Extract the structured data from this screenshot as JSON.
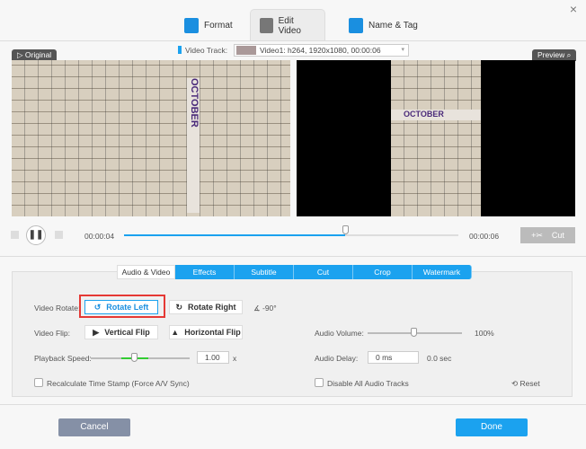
{
  "header": {
    "tabs": [
      {
        "label": "Format",
        "icon": "format-icon"
      },
      {
        "label": "Edit Video",
        "icon": "edit-video-icon",
        "active": true
      },
      {
        "label": "Name & Tag",
        "icon": "name-tag-icon"
      }
    ],
    "close": "×"
  },
  "track": {
    "label": "Video Track:",
    "value": "Video1: h264, 1920x1080, 00:00:06"
  },
  "preview": {
    "original_label": "Original",
    "preview_label": "Preview"
  },
  "player": {
    "current_time": "00:00:04",
    "total_time": "00:00:06",
    "progress": 0.66,
    "cut_label": "Cut"
  },
  "subtabs": [
    "Audio & Video",
    "Effects",
    "Subtitle",
    "Cut",
    "Crop",
    "Watermark"
  ],
  "panel": {
    "rotate_label": "Video Rotate:",
    "rotate_left": "Rotate Left",
    "rotate_right": "Rotate Right",
    "rotate_value": "-90°",
    "flip_label": "Video Flip:",
    "vertical_flip": "Vertical Flip",
    "horizontal_flip": "Horizontal Flip",
    "speed_label": "Playback Speed:",
    "speed_value": "1.00",
    "speed_unit": "x",
    "volume_label": "Audio Volume:",
    "volume_value": "100%",
    "delay_label": "Audio Delay:",
    "delay_value": "0 ms",
    "delay_sec": "0.0 sec",
    "recalc_label": "Recalculate Time Stamp (Force A/V Sync)",
    "disable_audio_label": "Disable All Audio Tracks",
    "reset_label": "Reset"
  },
  "footer": {
    "cancel": "Cancel",
    "done": "Done"
  },
  "colors": {
    "accent": "#1ba2ef",
    "highlight": "#e53935"
  }
}
